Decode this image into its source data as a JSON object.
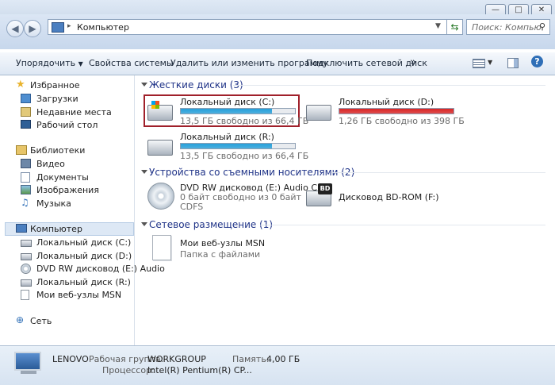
{
  "window": {
    "minimize": "—",
    "maximize": "□",
    "close": "✕"
  },
  "nav": {
    "back": "◀",
    "forward": "▶",
    "address": "Компьютер",
    "search_placeholder": "Поиск: Компью..."
  },
  "toolbar": {
    "organize": "Упорядочить",
    "system_props": "Свойства системы",
    "uninstall": "Удалить или изменить программу",
    "map_drive": "Подключить сетевой диск",
    "more": "»"
  },
  "sidebar": {
    "favorites": {
      "label": "Избранное",
      "items": [
        "Загрузки",
        "Недавние места",
        "Рабочий стол"
      ]
    },
    "libraries": {
      "label": "Библиотеки",
      "items": [
        "Видео",
        "Документы",
        "Изображения",
        "Музыка"
      ]
    },
    "computer": {
      "label": "Компьютер",
      "items": [
        "Локальный диск (C:)",
        "Локальный диск (D:)",
        "DVD RW дисковод (E:) Audio",
        "Локальный диск (R:)",
        "Мои веб-узлы MSN"
      ]
    },
    "network": {
      "label": "Сеть"
    }
  },
  "groups": {
    "hdd": {
      "label": "Жесткие диски (3)"
    },
    "removable": {
      "label": "Устройства со съемными носителями (2)"
    },
    "network": {
      "label": "Сетевое размещение (1)"
    }
  },
  "drives": [
    {
      "name": "Локальный диск (C:)",
      "free": "13,5 ГБ свободно из 66,4 ГБ",
      "used_fraction": 0.8,
      "color": "#26a0da"
    },
    {
      "name": "Локальный диск (D:)",
      "free": "1,26 ГБ свободно из 398 ГБ",
      "used_fraction": 0.997,
      "color": "#da2626"
    },
    {
      "name": "Локальный диск (R:)",
      "free": "13,5 ГБ свободно из 66,4 ГБ",
      "used_fraction": 0.8,
      "color": "#26a0da"
    }
  ],
  "removable": [
    {
      "name": "DVD RW дисковод (E:) Audio CD",
      "free": "0 байт свободно из 0 байт",
      "fs": "CDFS"
    },
    {
      "name": "Дисковод BD-ROM (F:)",
      "badge": "BD"
    }
  ],
  "network_items": [
    {
      "name": "Мои веб-узлы MSN",
      "desc": "Папка с файлами"
    }
  ],
  "status": {
    "computer_name": "LENOVO",
    "workgroup_label": "Рабочая группа:",
    "workgroup": "WORKGROUP",
    "memory_label": "Память:",
    "memory": "4,00 ГБ",
    "cpu_label": "Процессор:",
    "cpu": "Intel(R) Pentium(R) CP..."
  },
  "colors": {
    "selection": "#a0202a",
    "accent": "#1e3287"
  }
}
